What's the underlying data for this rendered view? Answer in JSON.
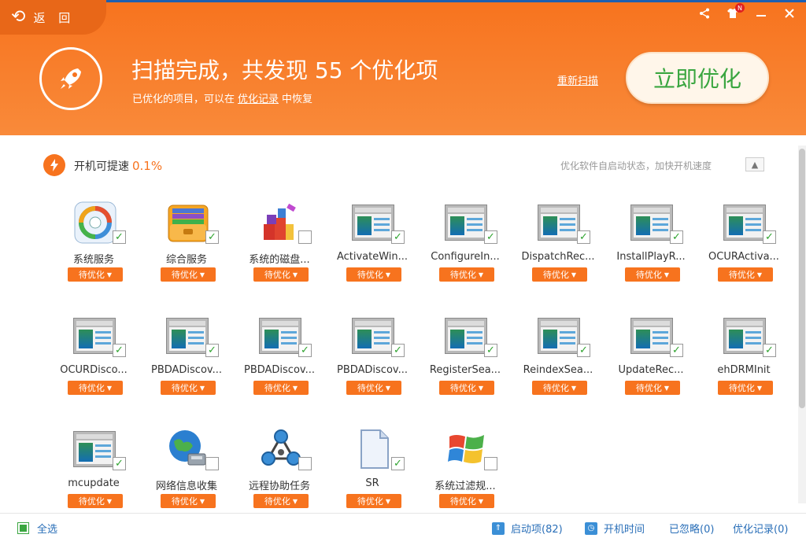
{
  "header": {
    "back_label": "返 回",
    "scan_title": "扫描完成，共发现 55 个优化项",
    "sub_prefix": "已优化的项目，可以在",
    "sub_link": "优化记录",
    "sub_suffix": "中恢复",
    "rescan": "重新扫描",
    "optimize_button": "立即优化",
    "badge": "N"
  },
  "info": {
    "speed_label": "开机可提速",
    "speed_value": "0.1%",
    "hint": "优化软件自启动状态，加快开机速度"
  },
  "items": [
    {
      "name": "系统服务",
      "status": "待优化",
      "checked": true,
      "icon": "system-service-icon"
    },
    {
      "name": "综合服务",
      "status": "待优化",
      "checked": true,
      "icon": "folder-icon"
    },
    {
      "name": "系统的磁盘...",
      "status": "待优化",
      "checked": false,
      "icon": "disk-cleanup-icon"
    },
    {
      "name": "ActivateWin...",
      "status": "待优化",
      "checked": true,
      "icon": "window-icon"
    },
    {
      "name": "ConfigureIn...",
      "status": "待优化",
      "checked": true,
      "icon": "window-icon"
    },
    {
      "name": "DispatchRec...",
      "status": "待优化",
      "checked": true,
      "icon": "window-icon"
    },
    {
      "name": "InstallPlayR...",
      "status": "待优化",
      "checked": true,
      "icon": "window-icon"
    },
    {
      "name": "OCURActiva...",
      "status": "待优化",
      "checked": true,
      "icon": "window-icon"
    },
    {
      "name": "OCURDisco...",
      "status": "待优化",
      "checked": true,
      "icon": "window-icon"
    },
    {
      "name": "PBDADiscov...",
      "status": "待优化",
      "checked": true,
      "icon": "window-icon"
    },
    {
      "name": "PBDADiscov...",
      "status": "待优化",
      "checked": true,
      "icon": "window-icon"
    },
    {
      "name": "PBDADiscov...",
      "status": "待优化",
      "checked": true,
      "icon": "window-icon"
    },
    {
      "name": "RegisterSea...",
      "status": "待优化",
      "checked": true,
      "icon": "window-icon"
    },
    {
      "name": "ReindexSea...",
      "status": "待优化",
      "checked": true,
      "icon": "window-icon"
    },
    {
      "name": "UpdateRec...",
      "status": "待优化",
      "checked": true,
      "icon": "window-icon"
    },
    {
      "name": "ehDRMInit",
      "status": "待优化",
      "checked": true,
      "icon": "window-icon"
    },
    {
      "name": "mcupdate",
      "status": "待优化",
      "checked": true,
      "icon": "window-icon"
    },
    {
      "name": "网络信息收集",
      "status": "待优化",
      "checked": false,
      "icon": "globe-network-icon"
    },
    {
      "name": "远程协助任务",
      "status": "待优化",
      "checked": false,
      "icon": "network-share-icon"
    },
    {
      "name": "SR",
      "status": "待优化",
      "checked": true,
      "icon": "document-icon"
    },
    {
      "name": "系统过滤规...",
      "status": "待优化",
      "checked": false,
      "icon": "windows-logo-icon"
    }
  ],
  "footer": {
    "select_all": "全选",
    "startup": "启动项(82)",
    "boot_time": "开机时间",
    "ignored": "已忽略(0)",
    "history": "优化记录(0)"
  },
  "colors": {
    "accent": "#f7731e",
    "green": "#3aa640",
    "link": "#2a6fb8"
  }
}
